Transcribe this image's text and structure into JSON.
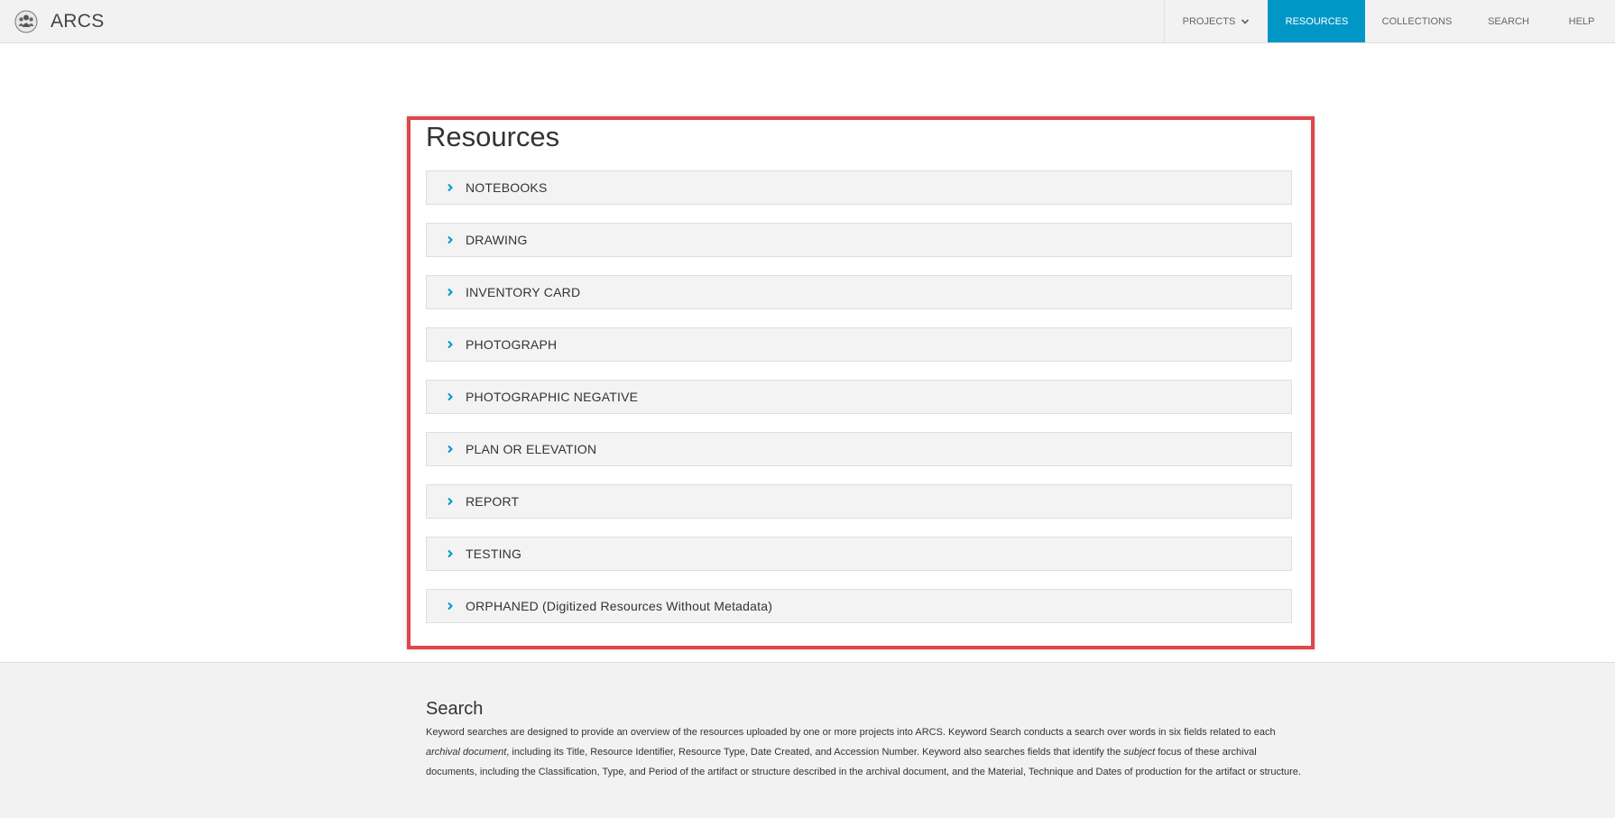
{
  "header": {
    "brand": "ARCS",
    "brand_icon": "people-group-icon",
    "nav": [
      {
        "label": "PROJECTS",
        "has_dropdown": true,
        "active": false
      },
      {
        "label": "RESOURCES",
        "active": true
      },
      {
        "label": "COLLECTIONS",
        "active": false
      },
      {
        "label": "SEARCH",
        "active": false
      },
      {
        "label": "HELP",
        "active": false
      }
    ]
  },
  "main": {
    "title": "Resources",
    "items": [
      {
        "label": "NOTEBOOKS"
      },
      {
        "label": "DRAWING"
      },
      {
        "label": "INVENTORY CARD"
      },
      {
        "label": "PHOTOGRAPH"
      },
      {
        "label": "PHOTOGRAPHIC NEGATIVE"
      },
      {
        "label": "PLAN OR ELEVATION"
      },
      {
        "label": "REPORT"
      },
      {
        "label": "TESTING"
      },
      {
        "label": "ORPHANED (Digitized Resources Without Metadata)"
      }
    ]
  },
  "footer": {
    "title": "Search",
    "text_1": "Keyword searches are designed to provide an overview of the resources uploaded by one or more projects into ARCS. Keyword Search conducts a search over words in six fields related to each ",
    "em_1": "archival document",
    "text_2": ", including its Title, Resource Identifier, Resource Type, Date Created, and Accession Number. Keyword also searches fields that identify the ",
    "em_2": "subject",
    "text_3": " focus of these archival documents, including the Classification, Type, and Period of the artifact or structure described in the archival document, and the Material, Technique and Dates of production for the artifact or structure."
  },
  "colors": {
    "accent": "#0097c7",
    "highlight_border": "#e0464b",
    "header_bg": "#f2f2f2"
  }
}
